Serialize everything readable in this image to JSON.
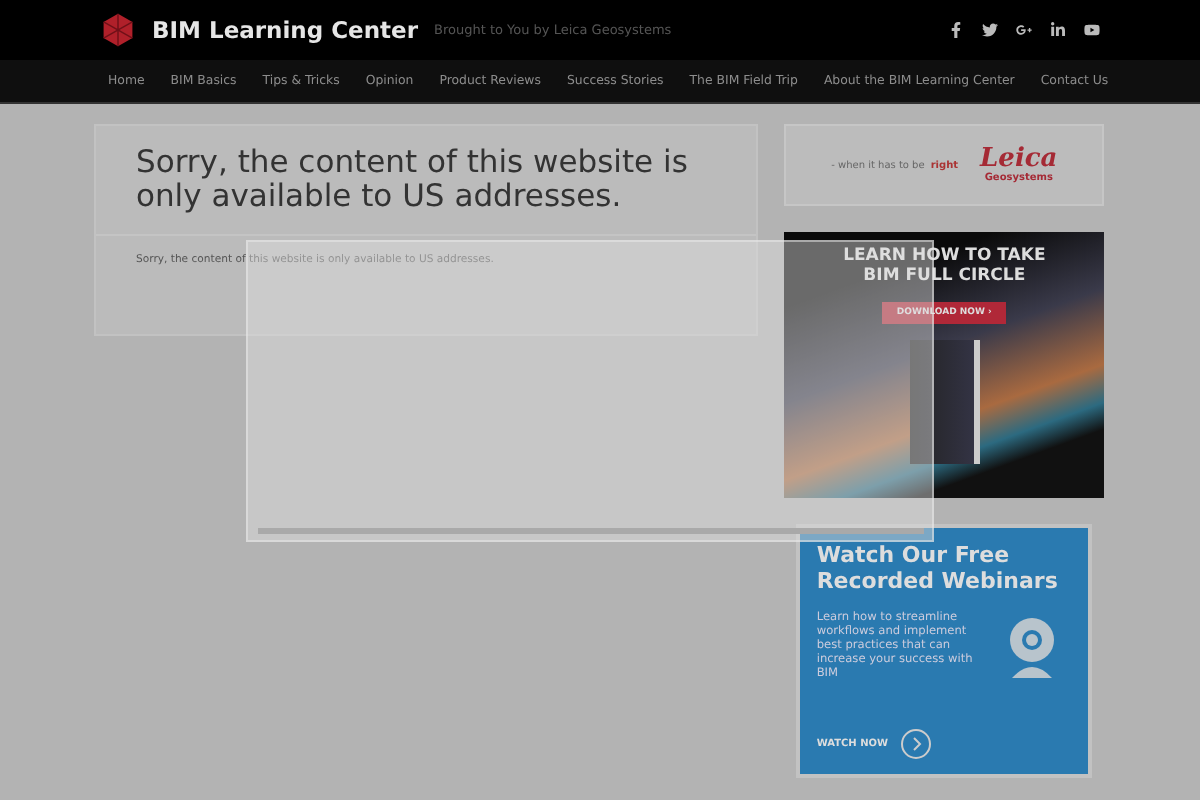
{
  "header": {
    "site_title": "BIM Learning Center",
    "tagline": "Brought to You by Leica Geosystems"
  },
  "nav": {
    "items": [
      "Home",
      "BIM Basics",
      "Tips & Tricks",
      "Opinion",
      "Product Reviews",
      "Success Stories",
      "The BIM Field Trip",
      "About the BIM Learning Center",
      "Contact Us"
    ]
  },
  "article": {
    "title": "Sorry, the content of this website is only available to US addresses.",
    "body": "Sorry, the content of this website is only available to US addresses."
  },
  "sidebar": {
    "leica_ad": {
      "slogan": "- when it has to be",
      "slogan_accent": "right",
      "logo": "Leica",
      "logo_sub": "Geosystems"
    },
    "ebook_ad": {
      "headline": "LEARN HOW TO TAKE BIM FULL CIRCLE",
      "button": "DOWNLOAD NOW ›"
    },
    "webinar_ad": {
      "headline": "Watch Our Free Recorded Webinars",
      "body": "Learn how to streamline workflows and implement best practices that can increase your success with BIM",
      "link": "WATCH NOW"
    }
  }
}
